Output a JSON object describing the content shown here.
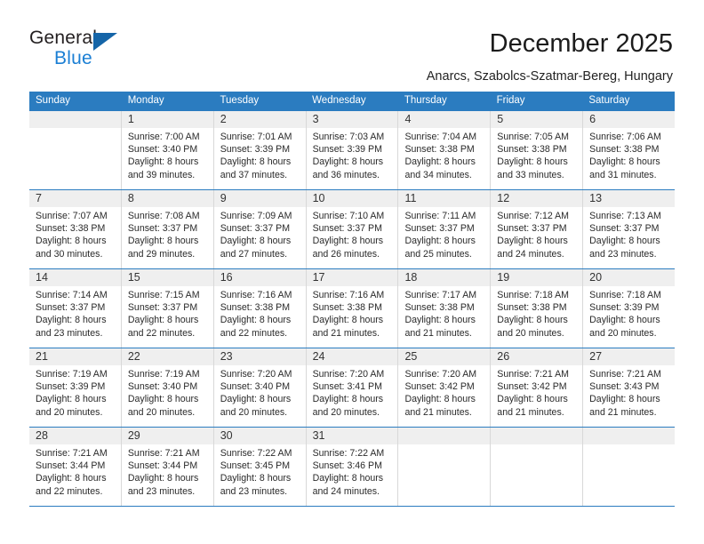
{
  "logo": {
    "word_top": "General",
    "word_bottom": "Blue",
    "triangle_color": "#1565a8",
    "blue_color": "#1b7fd4"
  },
  "header": {
    "title": "December 2025",
    "subtitle": "Anarcs, Szabolcs-Szatmar-Bereg, Hungary"
  },
  "theme": {
    "header_blue": "#2b7cc0",
    "day_band_gray": "#efefef",
    "cell_border": "#d8d8d8"
  },
  "calendar": {
    "weekdays": [
      "Sunday",
      "Monday",
      "Tuesday",
      "Wednesday",
      "Thursday",
      "Friday",
      "Saturday"
    ],
    "weeks": [
      [
        {
          "day": "",
          "empty": true
        },
        {
          "day": "1",
          "sunrise": "Sunrise: 7:00 AM",
          "sunset": "Sunset: 3:40 PM",
          "daylight1": "Daylight: 8 hours",
          "daylight2": "and 39 minutes."
        },
        {
          "day": "2",
          "sunrise": "Sunrise: 7:01 AM",
          "sunset": "Sunset: 3:39 PM",
          "daylight1": "Daylight: 8 hours",
          "daylight2": "and 37 minutes."
        },
        {
          "day": "3",
          "sunrise": "Sunrise: 7:03 AM",
          "sunset": "Sunset: 3:39 PM",
          "daylight1": "Daylight: 8 hours",
          "daylight2": "and 36 minutes."
        },
        {
          "day": "4",
          "sunrise": "Sunrise: 7:04 AM",
          "sunset": "Sunset: 3:38 PM",
          "daylight1": "Daylight: 8 hours",
          "daylight2": "and 34 minutes."
        },
        {
          "day": "5",
          "sunrise": "Sunrise: 7:05 AM",
          "sunset": "Sunset: 3:38 PM",
          "daylight1": "Daylight: 8 hours",
          "daylight2": "and 33 minutes."
        },
        {
          "day": "6",
          "sunrise": "Sunrise: 7:06 AM",
          "sunset": "Sunset: 3:38 PM",
          "daylight1": "Daylight: 8 hours",
          "daylight2": "and 31 minutes."
        }
      ],
      [
        {
          "day": "7",
          "sunrise": "Sunrise: 7:07 AM",
          "sunset": "Sunset: 3:38 PM",
          "daylight1": "Daylight: 8 hours",
          "daylight2": "and 30 minutes."
        },
        {
          "day": "8",
          "sunrise": "Sunrise: 7:08 AM",
          "sunset": "Sunset: 3:37 PM",
          "daylight1": "Daylight: 8 hours",
          "daylight2": "and 29 minutes."
        },
        {
          "day": "9",
          "sunrise": "Sunrise: 7:09 AM",
          "sunset": "Sunset: 3:37 PM",
          "daylight1": "Daylight: 8 hours",
          "daylight2": "and 27 minutes."
        },
        {
          "day": "10",
          "sunrise": "Sunrise: 7:10 AM",
          "sunset": "Sunset: 3:37 PM",
          "daylight1": "Daylight: 8 hours",
          "daylight2": "and 26 minutes."
        },
        {
          "day": "11",
          "sunrise": "Sunrise: 7:11 AM",
          "sunset": "Sunset: 3:37 PM",
          "daylight1": "Daylight: 8 hours",
          "daylight2": "and 25 minutes."
        },
        {
          "day": "12",
          "sunrise": "Sunrise: 7:12 AM",
          "sunset": "Sunset: 3:37 PM",
          "daylight1": "Daylight: 8 hours",
          "daylight2": "and 24 minutes."
        },
        {
          "day": "13",
          "sunrise": "Sunrise: 7:13 AM",
          "sunset": "Sunset: 3:37 PM",
          "daylight1": "Daylight: 8 hours",
          "daylight2": "and 23 minutes."
        }
      ],
      [
        {
          "day": "14",
          "sunrise": "Sunrise: 7:14 AM",
          "sunset": "Sunset: 3:37 PM",
          "daylight1": "Daylight: 8 hours",
          "daylight2": "and 23 minutes."
        },
        {
          "day": "15",
          "sunrise": "Sunrise: 7:15 AM",
          "sunset": "Sunset: 3:37 PM",
          "daylight1": "Daylight: 8 hours",
          "daylight2": "and 22 minutes."
        },
        {
          "day": "16",
          "sunrise": "Sunrise: 7:16 AM",
          "sunset": "Sunset: 3:38 PM",
          "daylight1": "Daylight: 8 hours",
          "daylight2": "and 22 minutes."
        },
        {
          "day": "17",
          "sunrise": "Sunrise: 7:16 AM",
          "sunset": "Sunset: 3:38 PM",
          "daylight1": "Daylight: 8 hours",
          "daylight2": "and 21 minutes."
        },
        {
          "day": "18",
          "sunrise": "Sunrise: 7:17 AM",
          "sunset": "Sunset: 3:38 PM",
          "daylight1": "Daylight: 8 hours",
          "daylight2": "and 21 minutes."
        },
        {
          "day": "19",
          "sunrise": "Sunrise: 7:18 AM",
          "sunset": "Sunset: 3:38 PM",
          "daylight1": "Daylight: 8 hours",
          "daylight2": "and 20 minutes."
        },
        {
          "day": "20",
          "sunrise": "Sunrise: 7:18 AM",
          "sunset": "Sunset: 3:39 PM",
          "daylight1": "Daylight: 8 hours",
          "daylight2": "and 20 minutes."
        }
      ],
      [
        {
          "day": "21",
          "sunrise": "Sunrise: 7:19 AM",
          "sunset": "Sunset: 3:39 PM",
          "daylight1": "Daylight: 8 hours",
          "daylight2": "and 20 minutes."
        },
        {
          "day": "22",
          "sunrise": "Sunrise: 7:19 AM",
          "sunset": "Sunset: 3:40 PM",
          "daylight1": "Daylight: 8 hours",
          "daylight2": "and 20 minutes."
        },
        {
          "day": "23",
          "sunrise": "Sunrise: 7:20 AM",
          "sunset": "Sunset: 3:40 PM",
          "daylight1": "Daylight: 8 hours",
          "daylight2": "and 20 minutes."
        },
        {
          "day": "24",
          "sunrise": "Sunrise: 7:20 AM",
          "sunset": "Sunset: 3:41 PM",
          "daylight1": "Daylight: 8 hours",
          "daylight2": "and 20 minutes."
        },
        {
          "day": "25",
          "sunrise": "Sunrise: 7:20 AM",
          "sunset": "Sunset: 3:42 PM",
          "daylight1": "Daylight: 8 hours",
          "daylight2": "and 21 minutes."
        },
        {
          "day": "26",
          "sunrise": "Sunrise: 7:21 AM",
          "sunset": "Sunset: 3:42 PM",
          "daylight1": "Daylight: 8 hours",
          "daylight2": "and 21 minutes."
        },
        {
          "day": "27",
          "sunrise": "Sunrise: 7:21 AM",
          "sunset": "Sunset: 3:43 PM",
          "daylight1": "Daylight: 8 hours",
          "daylight2": "and 21 minutes."
        }
      ],
      [
        {
          "day": "28",
          "sunrise": "Sunrise: 7:21 AM",
          "sunset": "Sunset: 3:44 PM",
          "daylight1": "Daylight: 8 hours",
          "daylight2": "and 22 minutes."
        },
        {
          "day": "29",
          "sunrise": "Sunrise: 7:21 AM",
          "sunset": "Sunset: 3:44 PM",
          "daylight1": "Daylight: 8 hours",
          "daylight2": "and 23 minutes."
        },
        {
          "day": "30",
          "sunrise": "Sunrise: 7:22 AM",
          "sunset": "Sunset: 3:45 PM",
          "daylight1": "Daylight: 8 hours",
          "daylight2": "and 23 minutes."
        },
        {
          "day": "31",
          "sunrise": "Sunrise: 7:22 AM",
          "sunset": "Sunset: 3:46 PM",
          "daylight1": "Daylight: 8 hours",
          "daylight2": "and 24 minutes."
        },
        {
          "day": "",
          "empty": true
        },
        {
          "day": "",
          "empty": true
        },
        {
          "day": "",
          "empty": true
        }
      ]
    ]
  }
}
